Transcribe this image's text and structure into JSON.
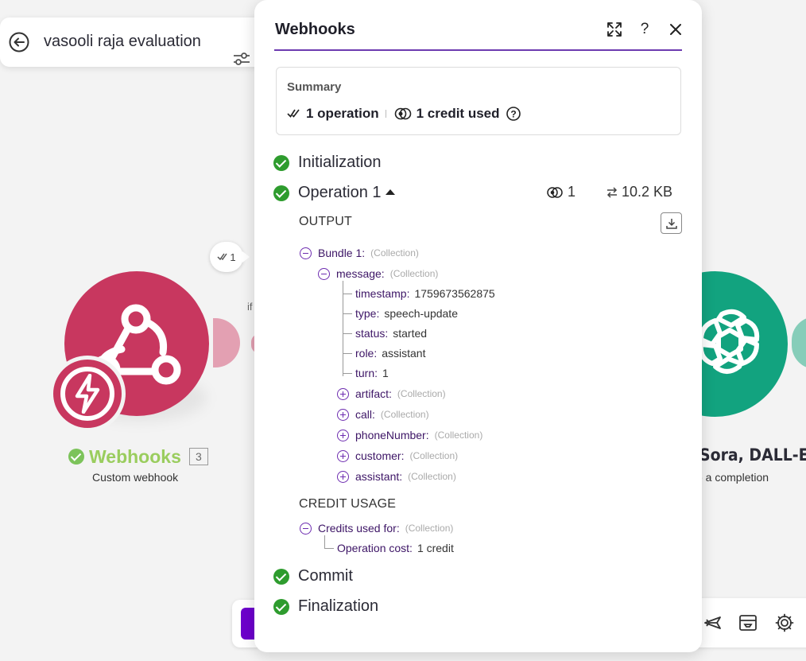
{
  "canvas": {
    "scenario_name": "vasooli raja evaluation",
    "left_module": {
      "name": "Webhooks",
      "count": "3",
      "subtitle": "Custom webhook",
      "operations_bubble": "1",
      "color": "#c8375f"
    },
    "right_module": {
      "name": "Sora, DALL-E, W",
      "subtitle": "e a completion",
      "color": "#12a37f"
    },
    "filter_fragment": "if"
  },
  "panel": {
    "title": "Webhooks",
    "header_icons": [
      "expand-icon",
      "help-icon",
      "close-icon"
    ],
    "help_label": "?",
    "summary": {
      "label": "Summary",
      "operations": "1 operation",
      "credits": "1 credit used"
    },
    "phases": {
      "initialization": "Initialization",
      "operation": "Operation 1",
      "commit": "Commit",
      "finalization": "Finalization"
    },
    "operation_stats": {
      "credits": "1",
      "size": "10.2 KB"
    },
    "output": {
      "label": "OUTPUT",
      "bundle": {
        "key": "Bundle 1:",
        "type": "(Collection)"
      },
      "message": {
        "key": "message:",
        "type": "(Collection)"
      },
      "fields": [
        {
          "key": "timestamp:",
          "value": "1759673562875"
        },
        {
          "key": "type:",
          "value": "speech-update"
        },
        {
          "key": "status:",
          "value": "started"
        },
        {
          "key": "role:",
          "value": "assistant"
        },
        {
          "key": "turn:",
          "value": "1"
        }
      ],
      "collections": [
        {
          "key": "artifact:",
          "type": "(Collection)"
        },
        {
          "key": "call:",
          "type": "(Collection)"
        },
        {
          "key": "phoneNumber:",
          "type": "(Collection)"
        },
        {
          "key": "customer:",
          "type": "(Collection)"
        },
        {
          "key": "assistant:",
          "type": "(Collection)"
        }
      ]
    },
    "credit_usage": {
      "label": "CREDIT USAGE",
      "credits_used_for": {
        "key": "Credits used for:",
        "type": "(Collection)"
      },
      "operation_cost": {
        "key": "Operation cost:",
        "value": "1 credit"
      }
    }
  },
  "colors": {
    "accent": "#6d3bb0",
    "success": "#2e9c2e",
    "tree_key": "#3d1566"
  }
}
